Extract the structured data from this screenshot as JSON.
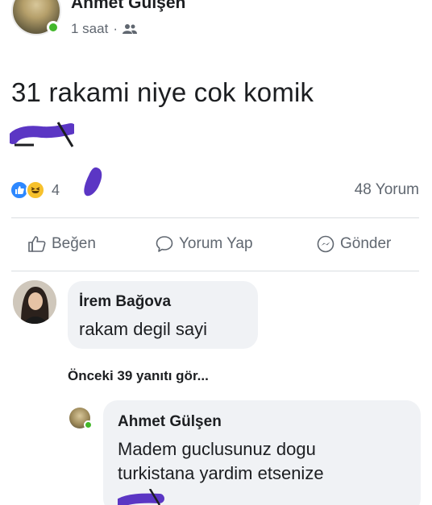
{
  "post": {
    "author": "Ahmet Gülşen",
    "time": "1 saat",
    "separator": "·",
    "text": "31 rakami niye cok komik",
    "reaction_count": "4",
    "comments_count": "48 Yorum"
  },
  "actions": {
    "like": "Beğen",
    "comment": "Yorum Yap",
    "send": "Gönder"
  },
  "comments": [
    {
      "author": "İrem Bağova",
      "text": "rakam degil sayi"
    }
  ],
  "prev_replies": "Önceki 39 yanıtı gör...",
  "reply": {
    "author": "Ahmet Gülşen",
    "text_line1": "Madem guclusunuz dogu",
    "text_line2": "turkistana yardim etsenize"
  },
  "colors": {
    "like_blue": "#2d88ff",
    "online_green": "#42b72a",
    "scribble_purple": "#5b36c4",
    "secondary_text": "#606770",
    "bubble_bg": "#f0f2f5"
  }
}
